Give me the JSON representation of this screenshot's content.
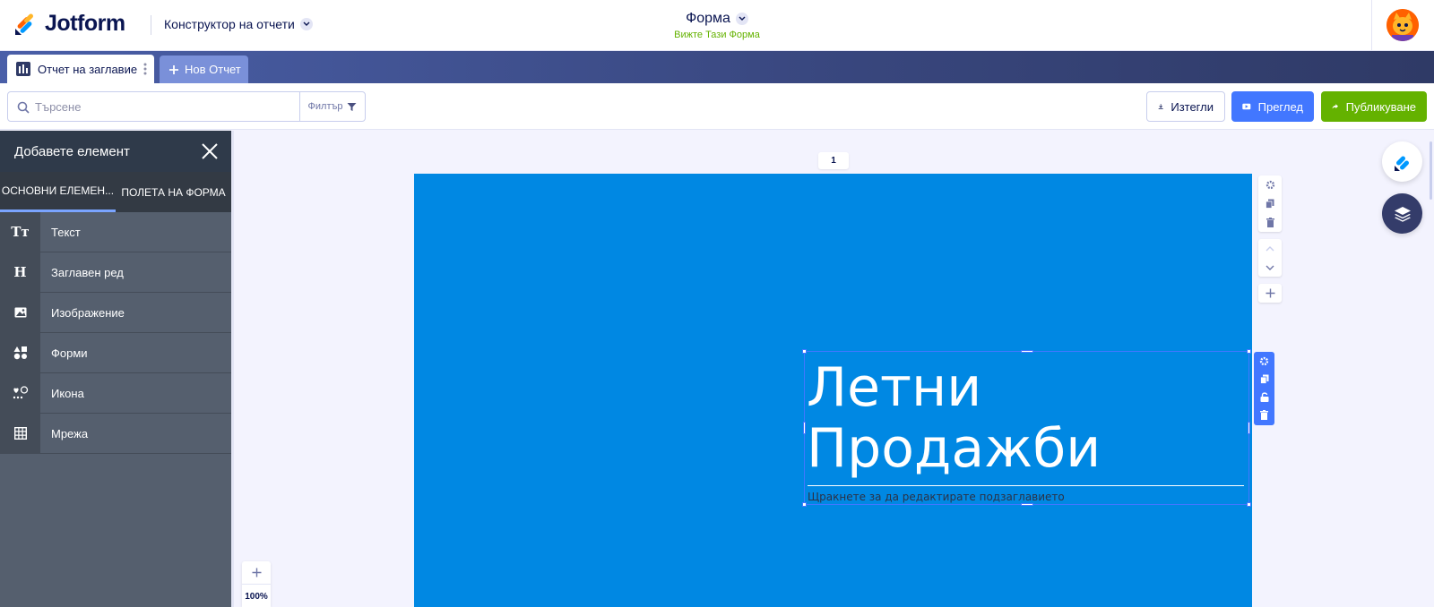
{
  "app": {
    "brand": "Jotform",
    "builder_label": "Конструктор на отчети",
    "form_title": "Форма",
    "form_subtitle": "Вижте Тази Форма"
  },
  "tabs": {
    "active_label": "Отчет на заглавие",
    "new_label": "Нов Отчет"
  },
  "toolbar": {
    "search_placeholder": "Търсене",
    "filter_label": "Филтър",
    "export_label": "Изтегли",
    "preview_label": "Преглед",
    "publish_label": "Публикуване"
  },
  "panel": {
    "title": "Добавете елемент",
    "tabs": [
      "ОСНОВНИ ЕЛЕМЕН...",
      "ПОЛЕТА НА ФОРМА"
    ],
    "items": [
      {
        "label": "Текст",
        "icon": "text-icon",
        "glyph": "Tт"
      },
      {
        "label": "Заглавен ред",
        "icon": "heading-icon",
        "glyph": "H"
      },
      {
        "label": "Изображение",
        "icon": "image-icon",
        "glyph": ""
      },
      {
        "label": "Форми",
        "icon": "shapes-icon",
        "glyph": ""
      },
      {
        "label": "Икона",
        "icon": "icon-element-icon",
        "glyph": ""
      },
      {
        "label": "Мрежа",
        "icon": "grid-icon",
        "glyph": ""
      }
    ]
  },
  "canvas": {
    "page_number": "1",
    "title_line1": "Летни",
    "title_line2": "Продажби",
    "subtitle": "Щракнете за да редактирате подзаглавието",
    "zoom": "100%"
  },
  "colors": {
    "slide_bg": "#0088e3",
    "accent_blue": "#4277ff",
    "publish_green": "#64b200",
    "panel_bg": "#555f6e"
  }
}
